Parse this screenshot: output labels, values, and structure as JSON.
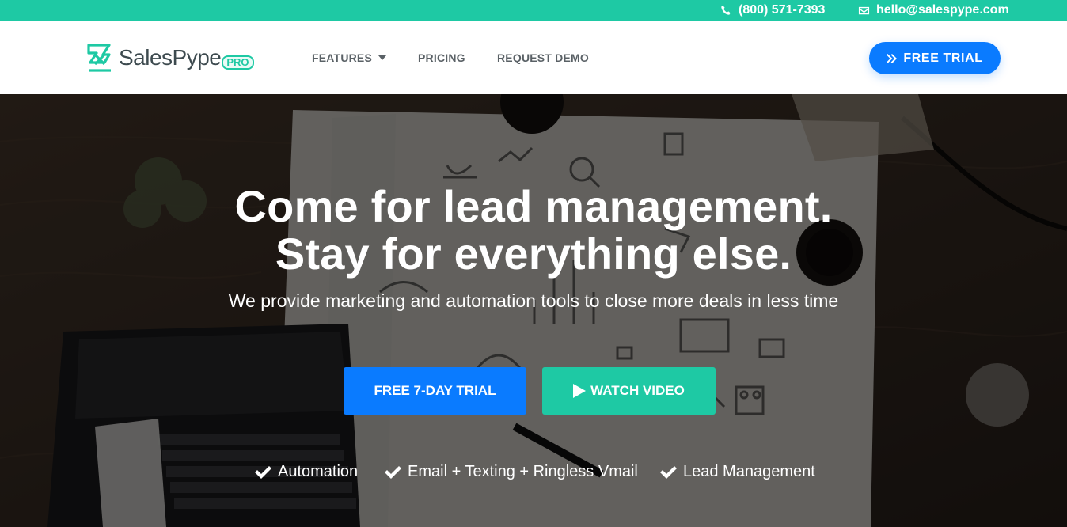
{
  "topbar": {
    "phone": "(800) 571-7393",
    "email": "hello@salespype.com",
    "phone_icon": "phone-icon",
    "email_icon": "envelope-icon"
  },
  "header": {
    "logo_text": "SalesPype",
    "logo_badge": "PRO",
    "nav": {
      "features": "FEATURES",
      "pricing": "PRICING",
      "request_demo": "REQUEST DEMO"
    },
    "cta": "FREE TRIAL"
  },
  "hero": {
    "title_line1": "Come for lead management.",
    "title_line2": "Stay for everything else.",
    "subtitle": "We provide marketing and automation tools to close more deals in less time",
    "buttons": {
      "trial": "FREE 7-DAY TRIAL",
      "video": "WATCH VIDEO"
    },
    "features": [
      "Automation",
      "Email + Texting + Ringless Vmail",
      "Lead Management"
    ]
  },
  "colors": {
    "accent_green": "#1ec9a4",
    "accent_blue": "#0a7bff"
  }
}
